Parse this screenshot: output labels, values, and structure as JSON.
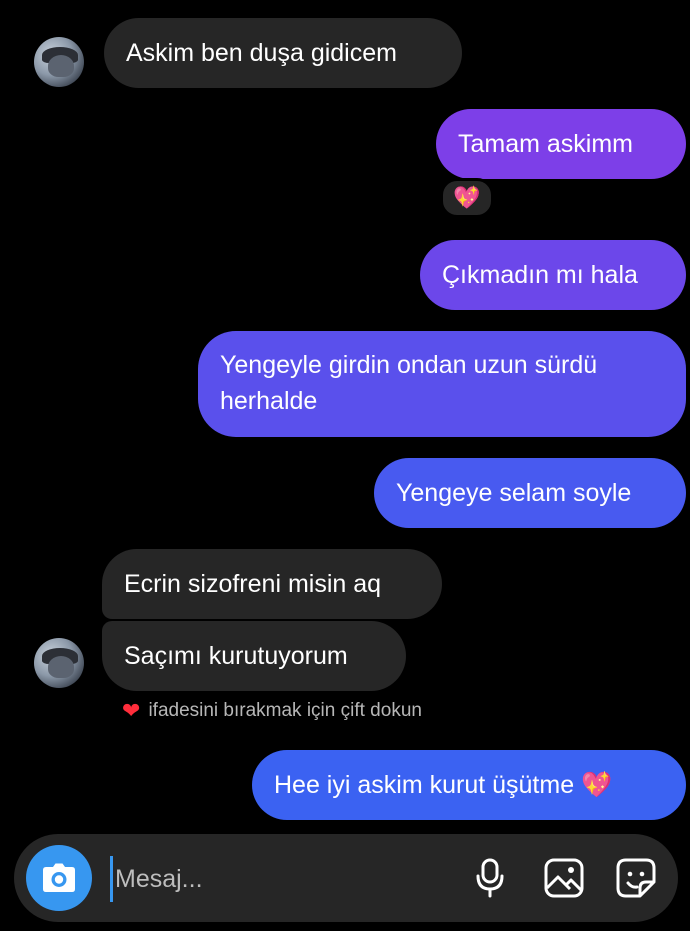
{
  "colors": {
    "background": "#000000",
    "incoming_bubble": "#262626",
    "outgoing_gradient_top": "#7d3fe8",
    "outgoing_gradient_bottom": "#3a5ef0",
    "accent_blue": "#3797f0",
    "reaction_heart": "#ff2d3b"
  },
  "messages": [
    {
      "direction": "incoming",
      "text": "Askim ben duşa gidicem"
    },
    {
      "direction": "outgoing",
      "text": "Tamam askimm",
      "reaction": "💖"
    },
    {
      "direction": "outgoing",
      "text": "Çıkmadın mı hala"
    },
    {
      "direction": "outgoing",
      "text": "Yengeyle girdin ondan uzun sürdü herhalde",
      "lines": [
        "Yengeyle girdin ondan uzun sürdü",
        "herhalde"
      ]
    },
    {
      "direction": "outgoing",
      "text": "Yengeye selam soyle"
    },
    {
      "direction": "incoming",
      "text": "Ecrin sizofreni misin aq"
    },
    {
      "direction": "incoming",
      "text": "Saçımı kurutuyorum"
    },
    {
      "direction": "outgoing",
      "text": "Hee iyi askim kurut üşütme 💖"
    }
  ],
  "reaction_hint": {
    "icon": "heart-icon",
    "text": "ifadesini bırakmak için çift dokun"
  },
  "composer": {
    "placeholder": "Mesaj...",
    "icons": [
      "camera-icon",
      "microphone-icon",
      "gallery-icon",
      "sticker-icon"
    ]
  }
}
